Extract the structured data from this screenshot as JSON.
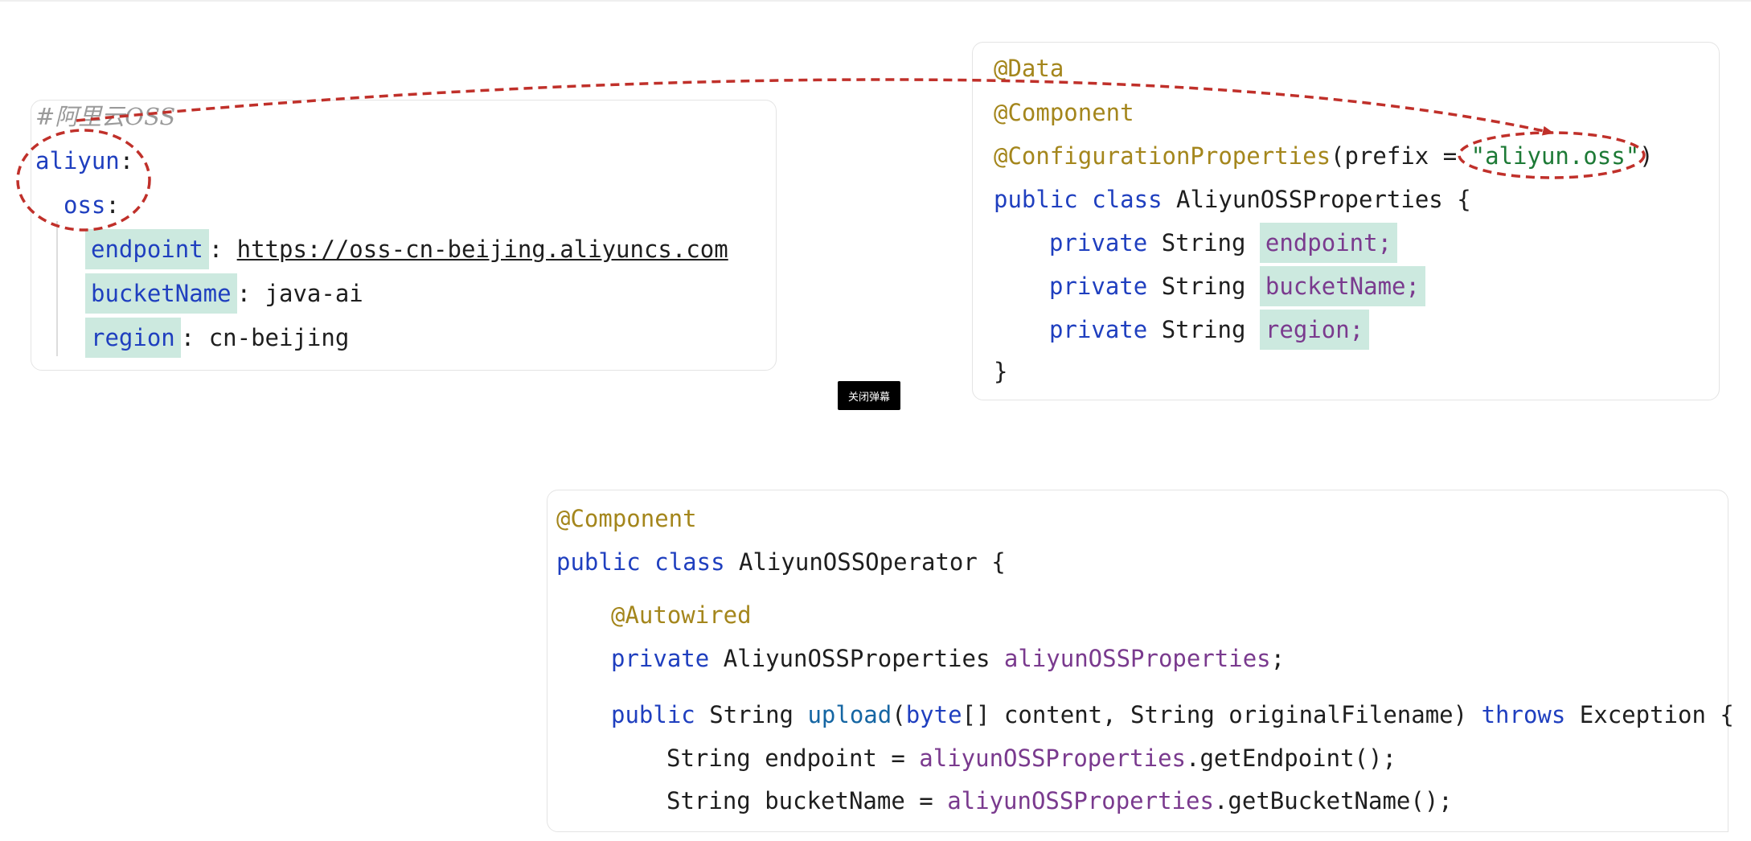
{
  "yaml": {
    "comment": "#阿里云OSS",
    "root_key": "aliyun",
    "sub_key": "oss",
    "colon": ":",
    "entries": [
      {
        "key": "endpoint",
        "value": "https://oss-cn-beijing.aliyuncs.com"
      },
      {
        "key": "bucketName",
        "value": "java-ai"
      },
      {
        "key": "region",
        "value": "cn-beijing"
      }
    ]
  },
  "properties_class": {
    "annotations": [
      "@Data",
      "@Component",
      "@ConfigurationProperties"
    ],
    "prefix_open": "(prefix = ",
    "prefix_value": "\"aliyun.oss\"",
    "prefix_close": ")",
    "kw_public": "public",
    "kw_class": "class",
    "class_name": "AliyunOSSProperties {",
    "kw_private": "private",
    "type_string": "String",
    "fields": [
      "endpoint;",
      "bucketName;",
      "region;"
    ],
    "closing_brace": "}"
  },
  "operator_class": {
    "annotation": "@Component",
    "kw_public": "public",
    "kw_class": "class",
    "class_name": "AliyunOSSOperator {",
    "autowired": "@Autowired",
    "kw_private": "private",
    "field_type": "AliyunOSSProperties",
    "field_name": "aliyunOSSProperties",
    "semicolon": ";",
    "method_type": "String",
    "method_name": "upload",
    "params_open": "(",
    "byte_kw": "byte",
    "params_rest": "[] content, String originalFilename) ",
    "kw_throws": "throws",
    "exception": "Exception {",
    "line_endpoint_prefix": "String endpoint = ",
    "line_endpoint_call": ".getEndpoint();",
    "line_bucket_prefix": "String bucketName = ",
    "line_bucket_call": ".getBucketName();"
  },
  "overlay": {
    "close_danmaku_label": "关闭弹幕"
  },
  "colors": {
    "keyword": "#1f3fbf",
    "annotation": "#a4861c",
    "string": "#1d7a36",
    "field": "#7a3a8e",
    "highlight": "#cce9df",
    "arrow": "#c0302a"
  }
}
